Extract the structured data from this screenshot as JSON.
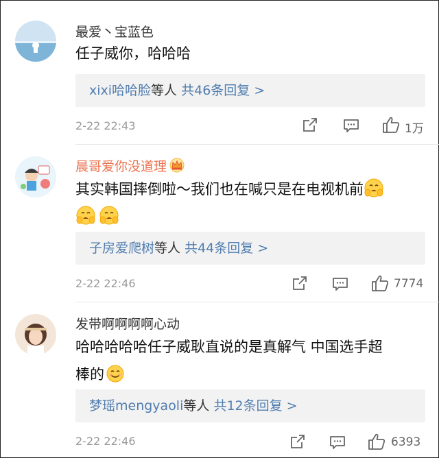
{
  "comments": [
    {
      "username": "最爱丶宝蓝色",
      "text": "任子威你，哈哈哈",
      "reply_user": "xixi哈哈脸",
      "reply_mid": "等人",
      "reply_count": "共46条回复 >",
      "time": "2-22 22:43",
      "likes": "1万"
    },
    {
      "username": "晨哥爱你没道理",
      "text": "其实韩国摔倒啦～我们也在喊只是在电视机前",
      "reply_user": "子房爱爬树",
      "reply_mid": "等人",
      "reply_count": "共44条回复 >",
      "time": "2-22 22:46",
      "likes": "7774"
    },
    {
      "username": "发带啊啊啊啊心动",
      "text_line1": "哈哈哈哈哈任子威耿直说的是真解气 中国选手超",
      "text_line2": "棒的",
      "reply_user": "梦瑶mengyaoli",
      "reply_mid": "等人",
      "reply_count": "共12条回复 >",
      "time": "2-22 22:46",
      "likes": "6393"
    }
  ]
}
